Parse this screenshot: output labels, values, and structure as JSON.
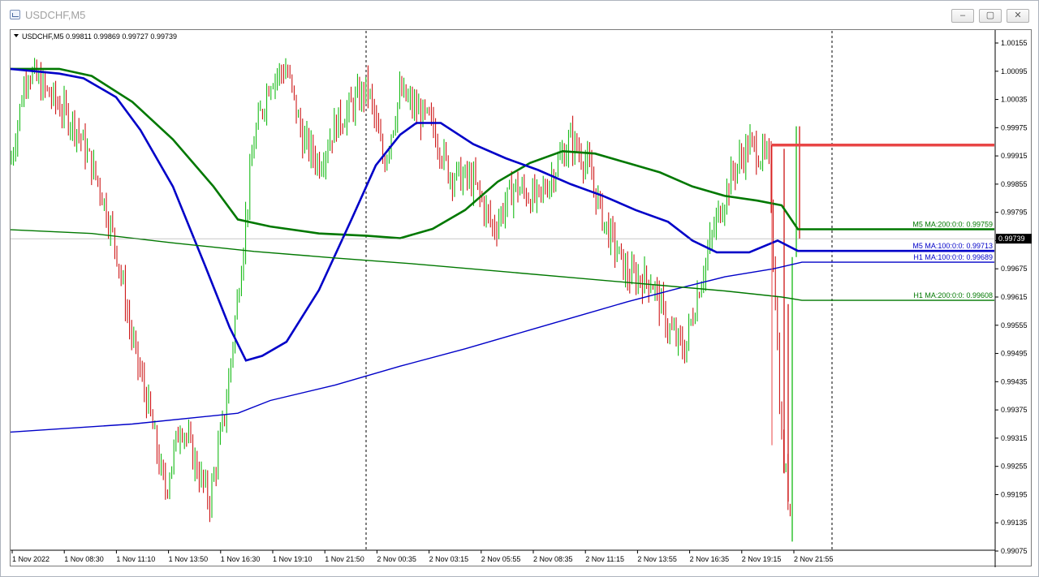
{
  "window": {
    "title": "USDCHF,M5",
    "buttons": [
      "–",
      "▢",
      "✕"
    ]
  },
  "chart_data": {
    "type": "candlestick",
    "symbol_info": "USDCHF,M5  0.99811 0.99869 0.99727 0.99739",
    "current_price": "0.99739",
    "ylim": [
      0.99075,
      1.00155
    ],
    "y_ticks": [
      "1.00155",
      "1.00095",
      "1.00035",
      "0.99975",
      "0.99915",
      "0.99855",
      "0.99795",
      "0.99735",
      "0.99675",
      "0.99615",
      "0.99555",
      "0.99495",
      "0.99435",
      "0.99375",
      "0.99315",
      "0.99255",
      "0.99195",
      "0.99135",
      "0.99075"
    ],
    "x_ticks": [
      "1 Nov 2022",
      "1 Nov 08:30",
      "1 Nov 11:10",
      "1 Nov 13:50",
      "1 Nov 16:30",
      "1 Nov 19:10",
      "1 Nov 21:50",
      "2 Nov 00:35",
      "2 Nov 03:15",
      "2 Nov 05:55",
      "2 Nov 08:35",
      "2 Nov 11:15",
      "2 Nov 13:55",
      "2 Nov 16:35",
      "2 Nov 19:15",
      "2 Nov 21:55"
    ],
    "colors": {
      "up": "#00b400",
      "down": "#c80000",
      "ma_green": "#007800",
      "ma_blue": "#0000c8",
      "resistance": "#e84646"
    },
    "horizontal_line": 0.99938,
    "moving_averages": [
      {
        "label": "M5 MA:200:0:0: 0.99759",
        "color": "#007800",
        "points": [
          [
            0,
            1.001
          ],
          [
            30,
            1.001
          ],
          [
            60,
            1.001
          ],
          [
            100,
            1.00085
          ],
          [
            150,
            1.0003
          ],
          [
            200,
            0.9995
          ],
          [
            250,
            0.9985
          ],
          [
            280,
            0.9978
          ],
          [
            320,
            0.99765
          ],
          [
            380,
            0.9975
          ],
          [
            440,
            0.99745
          ],
          [
            480,
            0.9974
          ],
          [
            520,
            0.9976
          ],
          [
            560,
            0.998
          ],
          [
            600,
            0.9986
          ],
          [
            640,
            0.999
          ],
          [
            680,
            0.99925
          ],
          [
            720,
            0.9992
          ],
          [
            760,
            0.999
          ],
          [
            800,
            0.9988
          ],
          [
            840,
            0.9985
          ],
          [
            880,
            0.9983
          ],
          [
            920,
            0.9982
          ],
          [
            950,
            0.9981
          ],
          [
            970,
            0.99759
          ],
          [
            1212,
            0.99759
          ]
        ]
      },
      {
        "label": "M5 MA:100:0:0: 0.99713",
        "color": "#0000c8",
        "points": [
          [
            0,
            1.001
          ],
          [
            30,
            1.00095
          ],
          [
            60,
            1.0009
          ],
          [
            90,
            1.0008
          ],
          [
            130,
            1.0004
          ],
          [
            160,
            0.9997
          ],
          [
            200,
            0.9985
          ],
          [
            240,
            0.9968
          ],
          [
            270,
            0.9955
          ],
          [
            290,
            0.9948
          ],
          [
            310,
            0.9949
          ],
          [
            340,
            0.9952
          ],
          [
            380,
            0.9963
          ],
          [
            420,
            0.9978
          ],
          [
            450,
            0.99895
          ],
          [
            480,
            0.9996
          ],
          [
            500,
            0.99985
          ],
          [
            530,
            0.99985
          ],
          [
            570,
            0.9994
          ],
          [
            610,
            0.9991
          ],
          [
            650,
            0.99885
          ],
          [
            690,
            0.99855
          ],
          [
            730,
            0.9983
          ],
          [
            770,
            0.998
          ],
          [
            810,
            0.99775
          ],
          [
            840,
            0.99735
          ],
          [
            870,
            0.9971
          ],
          [
            910,
            0.9971
          ],
          [
            945,
            0.99735
          ],
          [
            970,
            0.99713
          ],
          [
            1212,
            0.99713
          ]
        ]
      },
      {
        "label": "H1 MA:100:0:0: 0.99689",
        "color": "#0000c8",
        "points": [
          [
            0,
            0.99328
          ],
          [
            150,
            0.99345
          ],
          [
            280,
            0.99368
          ],
          [
            320,
            0.99395
          ],
          [
            400,
            0.99428
          ],
          [
            480,
            0.99468
          ],
          [
            560,
            0.99505
          ],
          [
            640,
            0.99545
          ],
          [
            700,
            0.99575
          ],
          [
            760,
            0.99605
          ],
          [
            820,
            0.99632
          ],
          [
            880,
            0.99658
          ],
          [
            940,
            0.99675
          ],
          [
            975,
            0.99689
          ],
          [
            1212,
            0.99689
          ]
        ]
      },
      {
        "label": "H1 MA:200:0:0: 0.99608",
        "color": "#007800",
        "points": [
          [
            0,
            0.99758
          ],
          [
            100,
            0.9975
          ],
          [
            200,
            0.9973
          ],
          [
            300,
            0.99712
          ],
          [
            400,
            0.99698
          ],
          [
            500,
            0.99685
          ],
          [
            600,
            0.9967
          ],
          [
            700,
            0.99655
          ],
          [
            800,
            0.9964
          ],
          [
            880,
            0.99628
          ],
          [
            950,
            0.99615
          ],
          [
            975,
            0.99608
          ],
          [
            1212,
            0.99608
          ]
        ]
      }
    ],
    "price_path": [
      [
        0,
        0.999
      ],
      [
        20,
        1.001
      ],
      [
        50,
        1.0004
      ],
      [
        80,
        0.9998
      ],
      [
        110,
        0.9985
      ],
      [
        130,
        0.9972
      ],
      [
        150,
        0.9952
      ],
      [
        170,
        0.9938
      ],
      [
        190,
        0.992
      ],
      [
        210,
        0.9935
      ],
      [
        230,
        0.9925
      ],
      [
        245,
        0.9918
      ],
      [
        265,
        0.9938
      ],
      [
        280,
        0.9962
      ],
      [
        300,
        0.9995
      ],
      [
        320,
        1.0008
      ],
      [
        340,
        1.001
      ],
      [
        360,
        0.9995
      ],
      [
        380,
        0.999
      ],
      [
        400,
        0.9998
      ],
      [
        420,
        1.0002
      ],
      [
        440,
        1.0006
      ],
      [
        460,
        0.999
      ],
      [
        480,
        1.0005
      ],
      [
        500,
        1.0001
      ],
      [
        520,
        0.9998
      ],
      [
        540,
        0.9988
      ],
      [
        570,
        0.9986
      ],
      [
        595,
        0.9976
      ],
      [
        620,
        0.9985
      ],
      [
        650,
        0.9982
      ],
      [
        690,
        0.9995
      ],
      [
        710,
        0.999
      ],
      [
        730,
        0.9978
      ],
      [
        760,
        0.9966
      ],
      [
        790,
        0.9965
      ],
      [
        810,
        0.9955
      ],
      [
        830,
        0.995
      ],
      [
        850,
        0.9965
      ],
      [
        870,
        0.9978
      ],
      [
        890,
        0.9988
      ],
      [
        910,
        0.9994
      ],
      [
        935,
        0.999
      ],
      [
        950,
        0.993
      ],
      [
        965,
        0.991
      ],
      [
        975,
        0.99739
      ]
    ]
  }
}
